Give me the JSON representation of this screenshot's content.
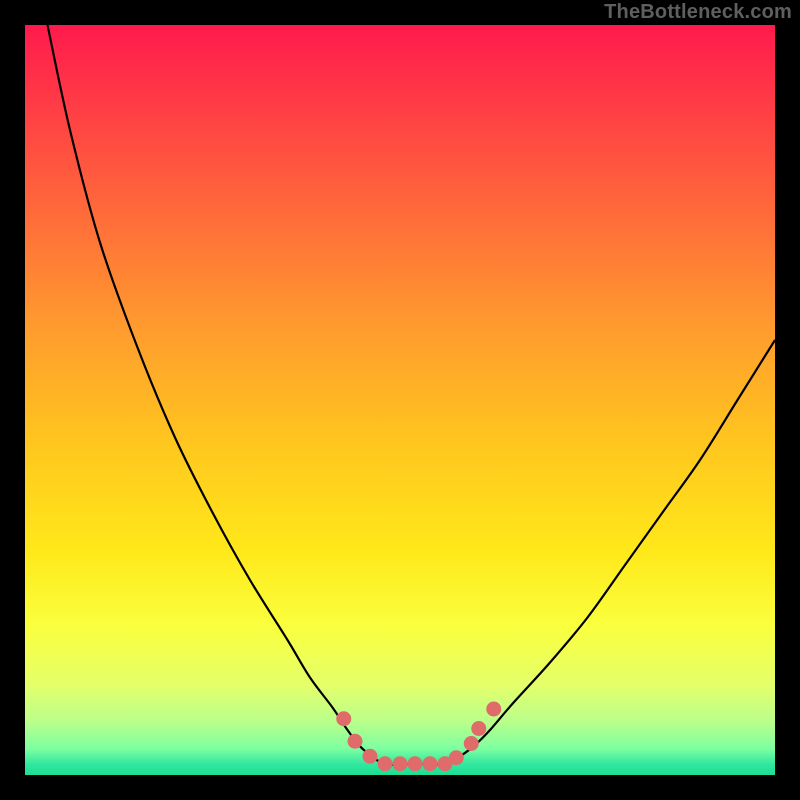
{
  "watermark": {
    "text": "TheBottleneck.com"
  },
  "colors": {
    "frame": "#000000",
    "curve": "#000000",
    "marker_fill": "#e06b6b",
    "marker_stroke": "#c84f4f",
    "gradient_stops": [
      {
        "offset": 0.0,
        "color": "#ff1a4d"
      },
      {
        "offset": 0.1,
        "color": "#ff3a46"
      },
      {
        "offset": 0.25,
        "color": "#ff6a3a"
      },
      {
        "offset": 0.4,
        "color": "#ff9a2e"
      },
      {
        "offset": 0.55,
        "color": "#ffc41f"
      },
      {
        "offset": 0.7,
        "color": "#ffe81a"
      },
      {
        "offset": 0.8,
        "color": "#faff3d"
      },
      {
        "offset": 0.88,
        "color": "#e4ff6a"
      },
      {
        "offset": 0.93,
        "color": "#b8ff8c"
      },
      {
        "offset": 0.965,
        "color": "#7cffa0"
      },
      {
        "offset": 0.985,
        "color": "#33e8a0"
      },
      {
        "offset": 1.0,
        "color": "#1adf93"
      }
    ]
  },
  "chart_data": {
    "type": "line",
    "title": "",
    "xlabel": "",
    "ylabel": "",
    "xlim": [
      0,
      100
    ],
    "ylim": [
      0,
      100
    ],
    "note": "V-shaped bottleneck curve. y≈0 is optimal (green). x is relative hardware scale; values estimated from pixels.",
    "series": [
      {
        "name": "bottleneck-curve",
        "x": [
          3,
          6,
          10,
          15,
          20,
          25,
          30,
          35,
          38,
          41,
          43,
          45,
          48,
          52,
          56,
          58,
          60,
          62,
          65,
          70,
          75,
          80,
          85,
          90,
          95,
          100
        ],
        "y": [
          100,
          86,
          71,
          57,
          45,
          35,
          26,
          18,
          13,
          9,
          6,
          3.5,
          1.5,
          1.5,
          1.5,
          2.5,
          4,
          6,
          9.5,
          15,
          21,
          28,
          35,
          42,
          50,
          58
        ]
      }
    ],
    "markers": {
      "name": "sample-points",
      "x": [
        42.5,
        44,
        46,
        48,
        50,
        52,
        54,
        56,
        57.5,
        59.5,
        60.5,
        62.5
      ],
      "y": [
        7.5,
        4.5,
        2.5,
        1.5,
        1.5,
        1.5,
        1.5,
        1.5,
        2.3,
        4.2,
        6.2,
        8.8
      ]
    }
  }
}
